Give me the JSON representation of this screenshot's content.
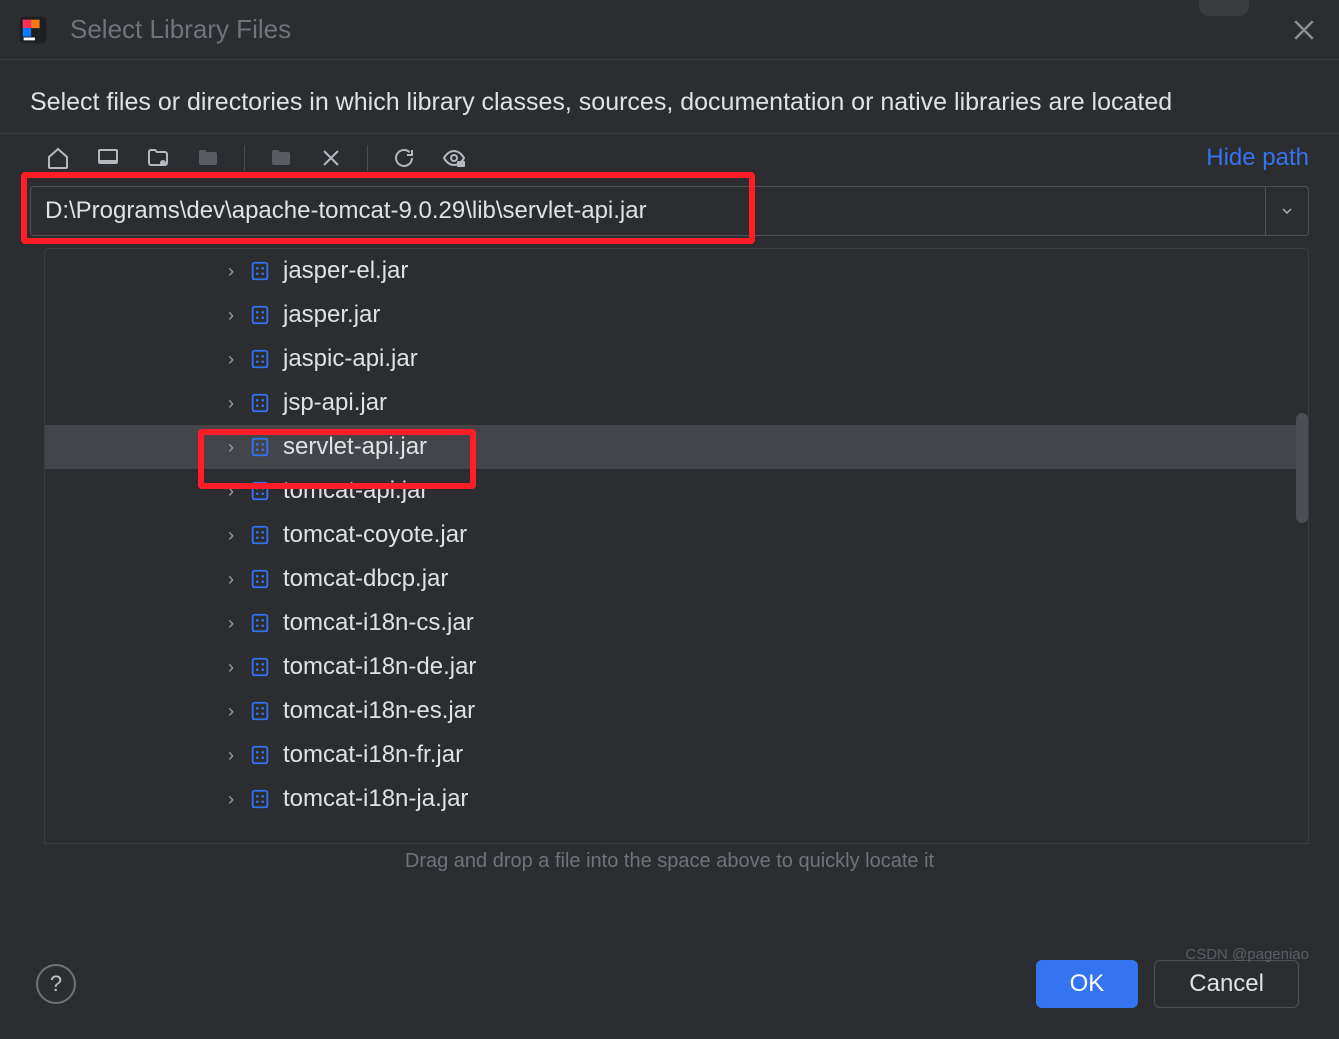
{
  "dialog": {
    "title": "Select Library Files",
    "description": "Select files or directories in which library classes, sources, documentation or native libraries are located",
    "hide_path_label": "Hide path",
    "path_value": "D:\\Programs\\dev\\apache-tomcat-9.0.29\\lib\\servlet-api.jar",
    "hint": "Drag and drop a file into the space above to quickly locate it"
  },
  "tree": {
    "items": [
      {
        "label": "jasper-el.jar",
        "selected": false
      },
      {
        "label": "jasper.jar",
        "selected": false
      },
      {
        "label": "jaspic-api.jar",
        "selected": false
      },
      {
        "label": "jsp-api.jar",
        "selected": false
      },
      {
        "label": "servlet-api.jar",
        "selected": true
      },
      {
        "label": "tomcat-api.jar",
        "selected": false
      },
      {
        "label": "tomcat-coyote.jar",
        "selected": false
      },
      {
        "label": "tomcat-dbcp.jar",
        "selected": false
      },
      {
        "label": "tomcat-i18n-cs.jar",
        "selected": false
      },
      {
        "label": "tomcat-i18n-de.jar",
        "selected": false
      },
      {
        "label": "tomcat-i18n-es.jar",
        "selected": false
      },
      {
        "label": "tomcat-i18n-fr.jar",
        "selected": false
      },
      {
        "label": "tomcat-i18n-ja.jar",
        "selected": false
      }
    ]
  },
  "buttons": {
    "ok": "OK",
    "cancel": "Cancel",
    "help": "?"
  },
  "watermark": "CSDN @pageniao",
  "colors": {
    "accent": "#3574f0",
    "highlight": "#ff1e28",
    "bg": "#2b2d30"
  }
}
